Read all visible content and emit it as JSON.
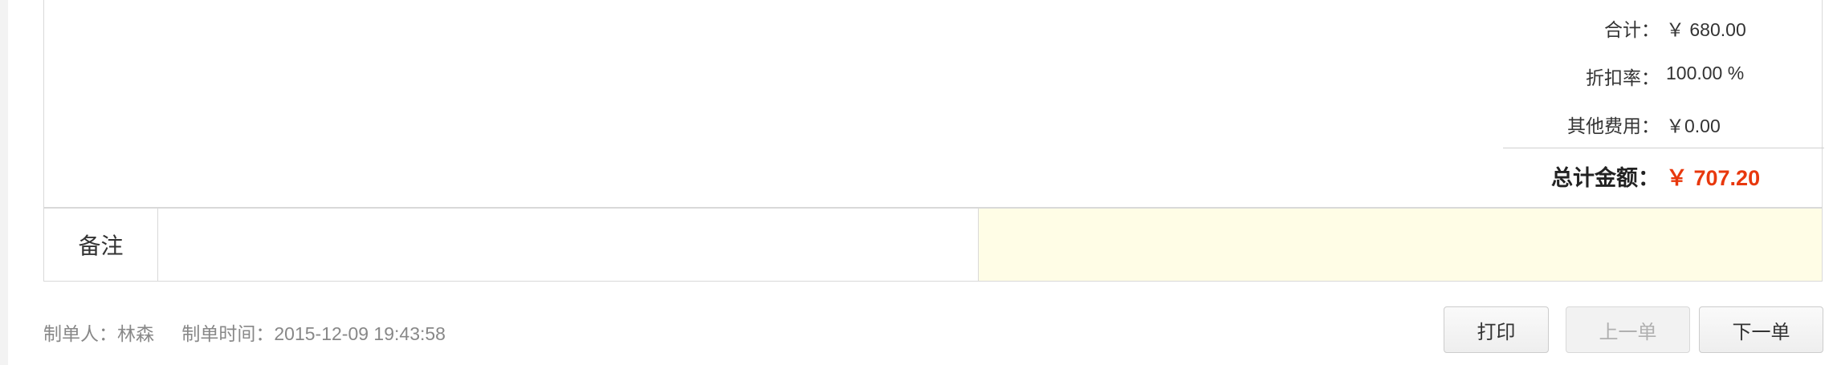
{
  "summary": {
    "subtotal_label": "合计：",
    "subtotal_value": "￥ 680.00",
    "discount_label": "折扣率：",
    "discount_value": "100.00 %",
    "other_fees_label": "其他费用：",
    "other_fees_value": "￥0.00",
    "total_label": "总计金额：",
    "total_value": "￥ 707.20"
  },
  "remarks": {
    "label": "备注",
    "value": ""
  },
  "footer": {
    "creator_label": "制单人：",
    "creator_name": "林森",
    "created_time_label": "制单时间：",
    "created_time": "2015-12-09 19:43:58"
  },
  "buttons": {
    "print": "打印",
    "previous": "上一单",
    "next": "下一单"
  },
  "colors": {
    "total_amount": "#e8380d",
    "note_background": "#fffde6"
  }
}
